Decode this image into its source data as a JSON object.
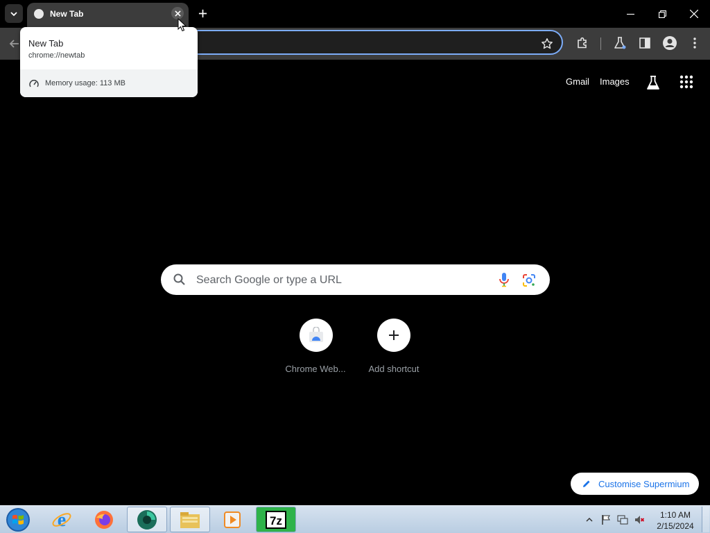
{
  "tab": {
    "title": "New Tab"
  },
  "hover_card": {
    "title": "New Tab",
    "url": "chrome://newtab",
    "memory": "Memory usage: 113 MB"
  },
  "ntp": {
    "links": {
      "gmail": "Gmail",
      "images": "Images"
    },
    "search_placeholder": "Search Google or type a URL",
    "shortcuts": [
      {
        "label": "Chrome Web...",
        "icon": "chrome-web-store-icon"
      },
      {
        "label": "Add shortcut",
        "icon": "plus-icon"
      }
    ],
    "customise_label": "Customise Supermium"
  },
  "taskbar": {
    "apps": [
      "internet-explorer-icon",
      "firefox-icon",
      "supermium-icon",
      "file-explorer-icon",
      "media-player-icon",
      "7zip-icon"
    ],
    "time": "1:10 AM",
    "date": "2/15/2024"
  },
  "colors": {
    "accent": "#7cacf8",
    "link_blue": "#1a73e8",
    "toolbar": "#3c3c3c"
  }
}
